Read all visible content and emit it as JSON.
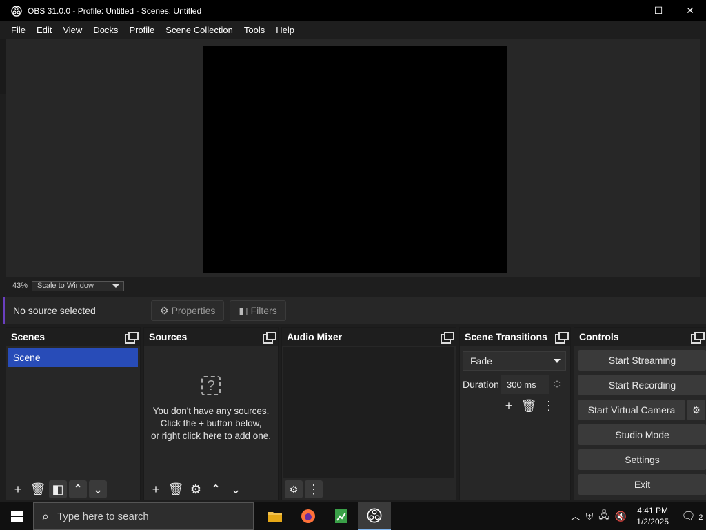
{
  "window": {
    "title": "OBS 31.0.0 - Profile: Untitled - Scenes: Untitled",
    "minimize": "—",
    "maximize": "☐",
    "close": "✕"
  },
  "menu": [
    "File",
    "Edit",
    "View",
    "Docks",
    "Profile",
    "Scene Collection",
    "Tools",
    "Help"
  ],
  "preview": {
    "zoom_percent": "43%",
    "scale_mode": "Scale to Window"
  },
  "source_toolbar": {
    "status": "No source selected",
    "properties_label": "Properties",
    "filters_label": "Filters"
  },
  "scenes": {
    "title": "Scenes",
    "items": [
      "Scene"
    ]
  },
  "sources": {
    "title": "Sources",
    "empty_line1": "You don't have any sources.",
    "empty_line2": "Click the + button below,",
    "empty_line3": "or right click here to add one."
  },
  "audio_mixer": {
    "title": "Audio Mixer"
  },
  "scene_transitions": {
    "title": "Scene Transitions",
    "transition": "Fade",
    "duration_label": "Duration",
    "duration_value": "300 ms"
  },
  "controls": {
    "title": "Controls",
    "start_streaming": "Start Streaming",
    "start_recording": "Start Recording",
    "start_virtual_camera": "Start Virtual Camera",
    "studio_mode": "Studio Mode",
    "settings": "Settings",
    "exit": "Exit"
  },
  "taskbar": {
    "search_placeholder": "Type here to search",
    "time": "4:41 PM",
    "date": "1/2/2025",
    "notification_count": "2"
  },
  "colors": {
    "accent_selected": "#284cb8",
    "status_bar_accent": "#6a3fbf",
    "panel_bg": "#272727",
    "header_bg": "#1e1e1e"
  }
}
